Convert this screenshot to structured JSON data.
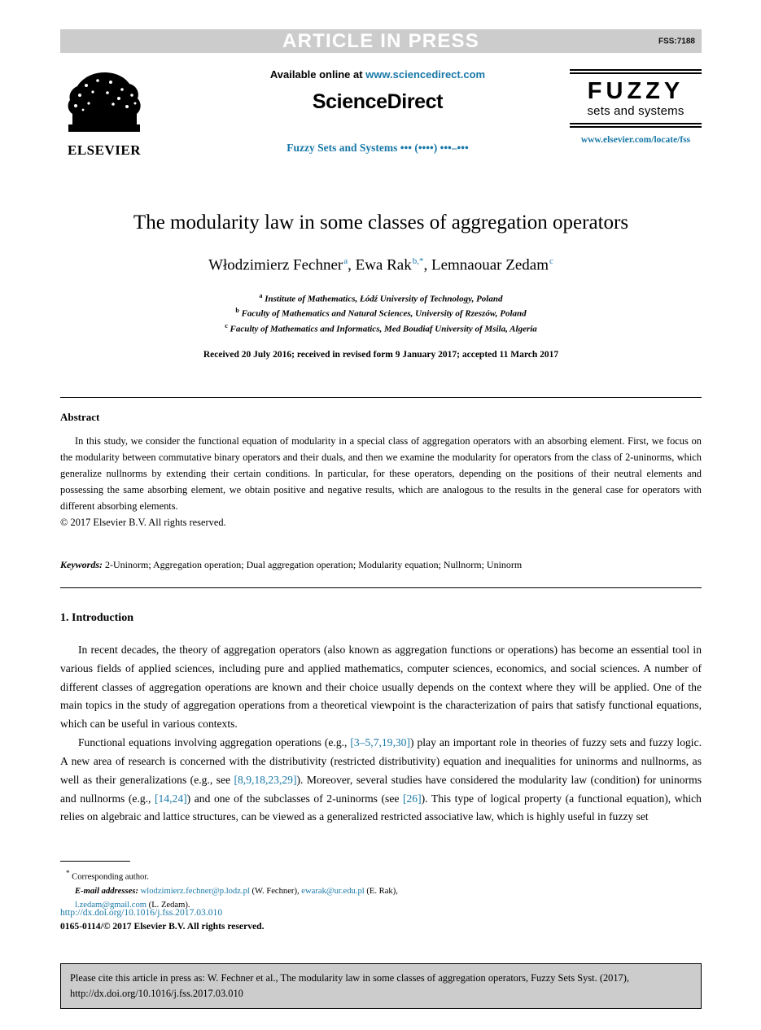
{
  "banner": {
    "label": "ARTICLE IN PRESS",
    "code": "FSS:7188",
    "bg_color": "#cccccc",
    "text_color": "#ffffff"
  },
  "masthead": {
    "publisher_logo_name": "ELSEVIER",
    "available_prefix": "Available online at ",
    "available_url": "www.sciencedirect.com",
    "platform": "ScienceDirect",
    "journal_citation_line": "Fuzzy Sets and Systems ••• (••••) •••–•••",
    "journal_logo_title": "FUZZY",
    "journal_logo_subtitle": "sets and systems",
    "journal_url": "www.elsevier.com/locate/fss",
    "link_color": "#1878a8"
  },
  "article": {
    "title": "The modularity law in some classes of aggregation operators",
    "authors": [
      {
        "name": "Włodzimierz Fechner",
        "marker": "a"
      },
      {
        "name": "Ewa Rak",
        "marker": "b,*"
      },
      {
        "name": "Lemnaouar Zedam",
        "marker": "c"
      }
    ],
    "authors_plain": "Włodzimierz Fechner a, Ewa Rak b,*, Lemnaouar Zedam c",
    "affiliations": [
      {
        "marker": "a",
        "text": "Institute of Mathematics, Łódź University of Technology, Poland"
      },
      {
        "marker": "b",
        "text": "Faculty of Mathematics and Natural Sciences, University of Rzeszów, Poland"
      },
      {
        "marker": "c",
        "text": "Faculty of Mathematics and Informatics, Med Boudiaf University of Msila, Algeria"
      }
    ],
    "history": "Received 20 July 2016; received in revised form 9 January 2017; accepted 11 March 2017"
  },
  "abstract": {
    "heading": "Abstract",
    "body": "In this study, we consider the functional equation of modularity in a special class of aggregation operators with an absorbing element. First, we focus on the modularity between commutative binary operators and their duals, and then we examine the modularity for operators from the class of 2-uninorms, which generalize nullnorms by extending their certain conditions. In particular, for these operators, depending on the positions of their neutral elements and possessing the same absorbing element, we obtain positive and negative results, which are analogous to the results in the general case for operators with different absorbing elements.",
    "copyright": "© 2017 Elsevier B.V. All rights reserved."
  },
  "keywords": {
    "label": "Keywords:",
    "value": " 2-Uninorm; Aggregation operation; Dual aggregation operation; Modularity equation; Nullnorm; Uninorm"
  },
  "introduction": {
    "heading": "1.  Introduction",
    "paragraph_1": "In recent decades, the theory of aggregation operators (also known as aggregation functions or operations) has become an essential tool in various fields of applied sciences, including pure and applied mathematics, computer sciences, economics, and social sciences. A number of different classes of aggregation operations are known and their choice usually depends on the context where they will be applied. One of the main topics in the study of aggregation operations from a theoretical viewpoint is the characterization of pairs that satisfy functional equations, which can be useful in various contexts.",
    "paragraph_2_part_1": "Functional equations involving aggregation operations (e.g., ",
    "citation_1": "[3–5,7,19,30]",
    "paragraph_2_part_2": ") play an important role in theories of fuzzy sets and fuzzy logic. A new area of research is concerned with the distributivity (restricted distributivity) equation and inequalities for uninorms and nullnorms, as well as their generalizations (e.g., see ",
    "citation_2": "[8,9,18,23,29]",
    "paragraph_2_part_3": "). Moreover, several studies have considered the modularity law (condition) for uninorms and nullnorms (e.g., ",
    "citation_3": "[14,24]",
    "paragraph_2_part_4": ") and one of the subclasses of 2-uninorms (see ",
    "citation_4": "[26]",
    "paragraph_2_part_5": "). This type of logical property (a functional equation), which relies on algebraic and lattice structures, can be viewed as a generalized restricted associative law, which is highly useful in fuzzy set"
  },
  "footnotes": {
    "corresponding_marker": "*",
    "corresponding_text": "Corresponding author.",
    "emails_label": "E-mail addresses:",
    "emails": [
      {
        "address": "wlodzimierz.fechner@p.lodz.pl",
        "attribution": " (W. Fechner), "
      },
      {
        "address": "ewarak@ur.edu.pl",
        "attribution": " (E. Rak), "
      },
      {
        "address": "l.zedam@gmail.com",
        "attribution": " (L. Zedam)."
      }
    ],
    "doi": "http://dx.doi.org/10.1016/j.fss.2017.03.010",
    "issn_line": "0165-0114/© 2017 Elsevier B.V. All rights reserved."
  },
  "cite_box": {
    "line_1": "Please cite this article in press as: W. Fechner et al., The modularity law in some classes of aggregation operators, Fuzzy Sets Syst. (2017),",
    "line_2": "http://dx.doi.org/10.1016/j.fss.2017.03.010",
    "bg_color": "#cccccc"
  }
}
